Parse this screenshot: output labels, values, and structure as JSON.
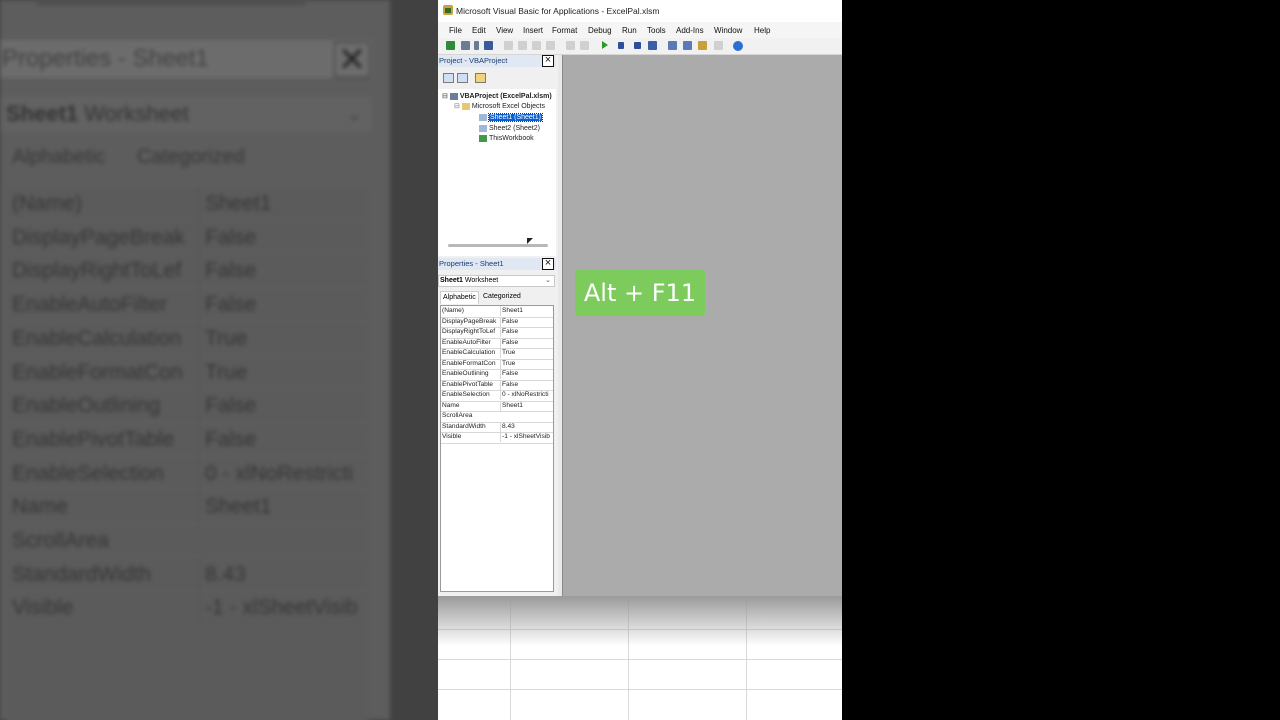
{
  "window": {
    "title": "Microsoft Visual Basic for Applications - ExcelPal.xlsm"
  },
  "menu": [
    "File",
    "Edit",
    "View",
    "Insert",
    "Format",
    "Debug",
    "Run",
    "Tools",
    "Add-Ins",
    "Window",
    "Help"
  ],
  "project_explorer": {
    "title": "Project - VBAProject",
    "tree": {
      "root": "VBAProject (ExcelPal.xlsm)",
      "folder": "Microsoft Excel Objects",
      "items": [
        "Sheet1 (Sheet1)",
        "Sheet2 (Sheet2)",
        "ThisWorkbook"
      ],
      "selected": "Sheet1 (Sheet1)"
    }
  },
  "properties": {
    "title": "Properties - Sheet1",
    "object_name": "Sheet1",
    "object_type": "Worksheet",
    "tabs": [
      "Alphabetic",
      "Categorized"
    ],
    "active_tab": "Alphabetic",
    "rows": [
      {
        "name": "(Name)",
        "value": "Sheet1"
      },
      {
        "name": "DisplayPageBreak",
        "value": "False"
      },
      {
        "name": "DisplayRightToLef",
        "value": "False"
      },
      {
        "name": "EnableAutoFilter",
        "value": "False"
      },
      {
        "name": "EnableCalculation",
        "value": "True"
      },
      {
        "name": "EnableFormatCon",
        "value": "True"
      },
      {
        "name": "EnableOutlining",
        "value": "False"
      },
      {
        "name": "EnablePivotTable",
        "value": "False"
      },
      {
        "name": "EnableSelection",
        "value": "0 - xlNoRestricti"
      },
      {
        "name": "Name",
        "value": "Sheet1"
      },
      {
        "name": "ScrollArea",
        "value": ""
      },
      {
        "name": "StandardWidth",
        "value": "8.43"
      },
      {
        "name": "Visible",
        "value": "-1 - xlSheetVisib"
      }
    ]
  },
  "overlay": {
    "caption": "Alt + F11"
  },
  "colors": {
    "caption_bg": "#7dcb5d",
    "selection": "#0a5fd2",
    "workspace": "#ababab"
  }
}
